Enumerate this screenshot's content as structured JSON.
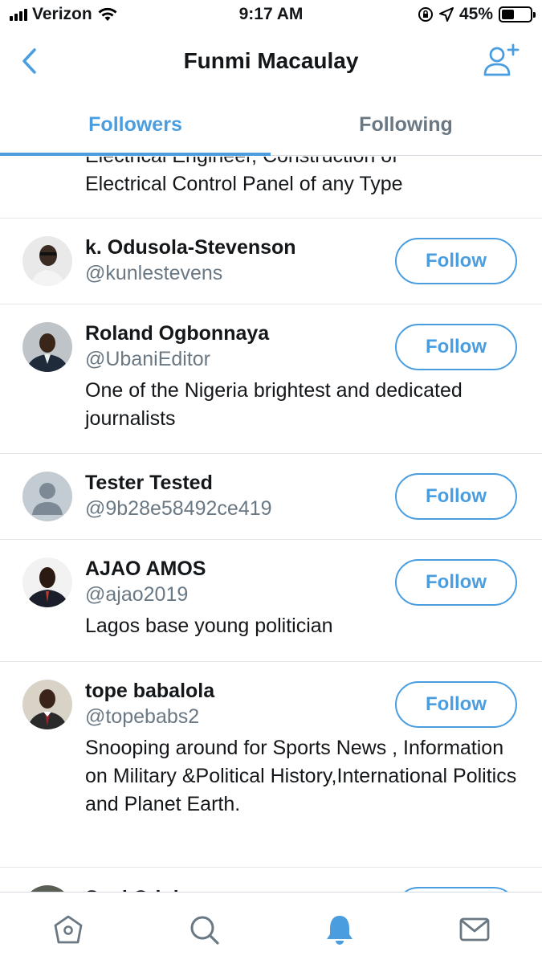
{
  "status_bar": {
    "carrier": "Verizon",
    "time": "9:17 AM",
    "battery": "45%",
    "battery_level": 0.45
  },
  "header": {
    "title": "Funmi Macaulay"
  },
  "tabs": [
    {
      "label": "Followers",
      "active": true
    },
    {
      "label": "Following",
      "active": false
    }
  ],
  "partial_bio": {
    "line1": "Electrical Engineer, Construction of",
    "line2": "Electrical Control Panel of any Type"
  },
  "users": [
    {
      "name": "k. Odusola-Stevenson",
      "handle": "@kunlestevens",
      "bio": "",
      "follow_label": "Follow"
    },
    {
      "name": "Roland Ogbonnaya",
      "handle": "@UbaniEditor",
      "bio": "One of the Nigeria brightest and dedicated journalists",
      "follow_label": "Follow"
    },
    {
      "name": "Tester Tested",
      "handle": "@9b28e58492ce419",
      "bio": "",
      "follow_label": "Follow"
    },
    {
      "name": "AJAO AMOS",
      "handle": "@ajao2019",
      "bio": "Lagos base young politician",
      "follow_label": "Follow"
    },
    {
      "name": "tope babalola",
      "handle": "@topebabs2",
      "bio": "Snooping around for Sports News , Information on Military &Political History,International Politics and Planet Earth.",
      "follow_label": "Follow"
    }
  ],
  "peek_user": {
    "name": "Segi Odulana"
  },
  "tabbar": [
    "home-icon",
    "search-icon",
    "notifications-icon",
    "messages-icon"
  ],
  "colors": {
    "accent": "#4a9ee0",
    "secondary_text": "#6a7884",
    "divider": "#e1e6ea"
  }
}
